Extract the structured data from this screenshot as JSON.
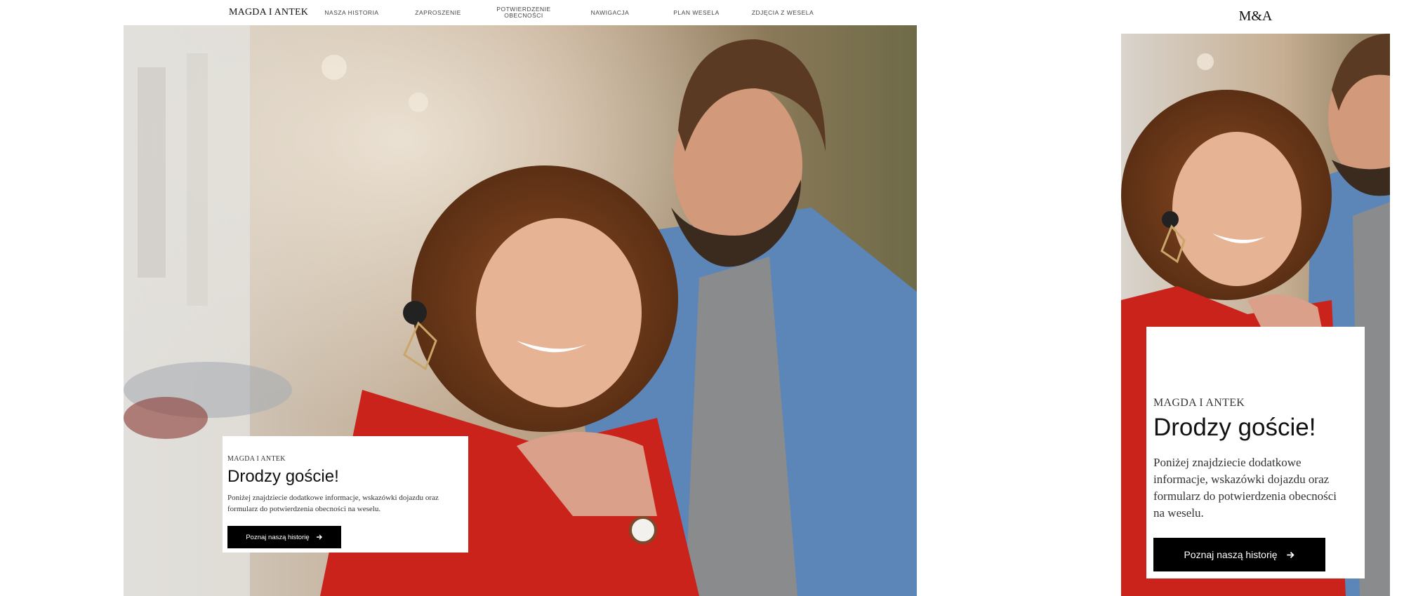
{
  "desktop": {
    "nav": {
      "brand": "MAGDA I ANTEK",
      "items": [
        {
          "label": "NASZA HISTORIA"
        },
        {
          "label": "ZAPROSZENIE"
        },
        {
          "label": "POTWIERDZENIE OBECNOŚCI"
        },
        {
          "label": "NAWIGACJA"
        },
        {
          "label": "PLAN WESELA"
        },
        {
          "label": "ZDJĘCIA Z WESELA"
        }
      ]
    },
    "hero": {
      "eyebrow": "MAGDA I ANTEK",
      "title": "Drodzy goście!",
      "description": "Poniżej znajdziecie dodatkowe informacje, wskazówki dojazdu oraz formularz do potwierdzenia obecności na weselu.",
      "cta_label": "Poznaj naszą historię",
      "cta_icon": "arrow-right-icon",
      "photo": "couple-photo"
    }
  },
  "mobile": {
    "logo": "M&A",
    "hero": {
      "eyebrow": "MAGDA I ANTEK",
      "title": "Drodzy goście!",
      "description": "Poniżej znajdziecie dodatkowe informacje, wskazówki dojazdu oraz formularz do potwierdzenia obecności na weselu.",
      "cta_label": "Poznaj naszą historię",
      "cta_icon": "arrow-right-icon",
      "photo": "couple-photo"
    }
  },
  "colors": {
    "accent": "#000000",
    "card_bg": "#ffffff",
    "jacket_red": "#c9231b",
    "denim_blue": "#5d86b8"
  }
}
